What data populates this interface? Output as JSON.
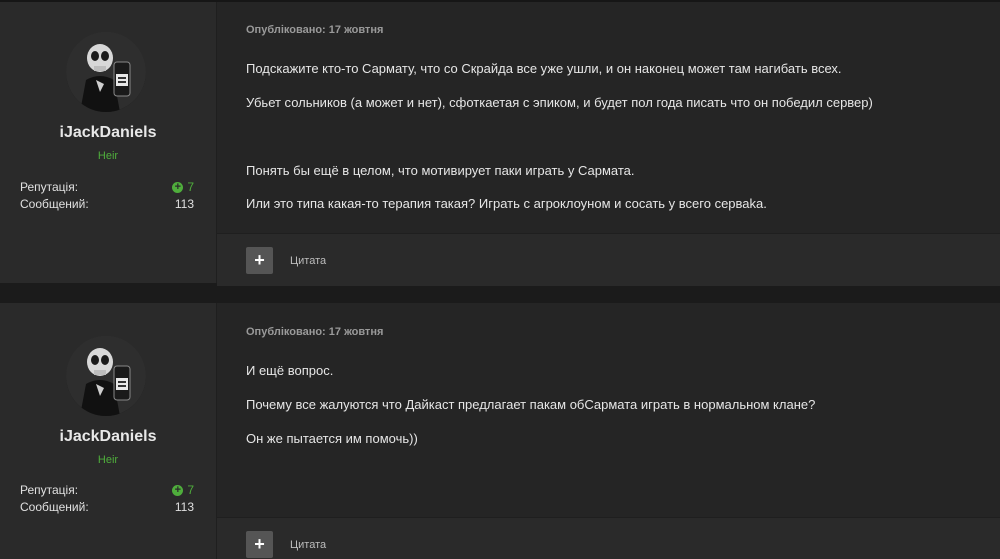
{
  "posts": [
    {
      "author": {
        "username": "iJackDaniels",
        "rank": "Heir",
        "reputation_label": "Репутація:",
        "reputation_value": "7",
        "messages_label": "Сообщений:",
        "messages_value": "113",
        "avatar_icon": "skull-jack-daniels-avatar"
      },
      "published": "Опубліковано: 17 жовтня",
      "lines": [
        "Подскажите кто-то Сармату, что со Скрайда все уже ушли, и он наконец может там нагибать всех.",
        "Убьет сольников (а может и нет), сфоткаетая с эпиком, и будет пол года писать что он победил сервер)",
        "Понять бы ещё в целом, что мотивирует паки играть у Сармата.",
        "Или это типа какая-то терапия такая? Играть с агроклоуном и сосать у всего серваka."
      ],
      "quote_icon": "plus-icon",
      "quote_label": "Цитата"
    },
    {
      "author": {
        "username": "iJackDaniels",
        "rank": "Heir",
        "reputation_label": "Репутація:",
        "reputation_value": "7",
        "messages_label": "Сообщений:",
        "messages_value": "113",
        "avatar_icon": "skull-jack-daniels-avatar"
      },
      "published": "Опубліковано: 17 жовтня",
      "lines": [
        "И ещё вопрос.",
        "Почему все жалуются что Дайкаст предлагает пакам обСармата играть в нормальном клане?",
        "Он же пытается им помочь))"
      ],
      "quote_icon": "plus-icon",
      "quote_label": "Цитата"
    }
  ],
  "colors": {
    "background": "#1b1b1b",
    "panel": "#252525",
    "author_panel": "#2a2a2a",
    "rank_green": "#4fae3c",
    "text": "#e6e6e6"
  }
}
